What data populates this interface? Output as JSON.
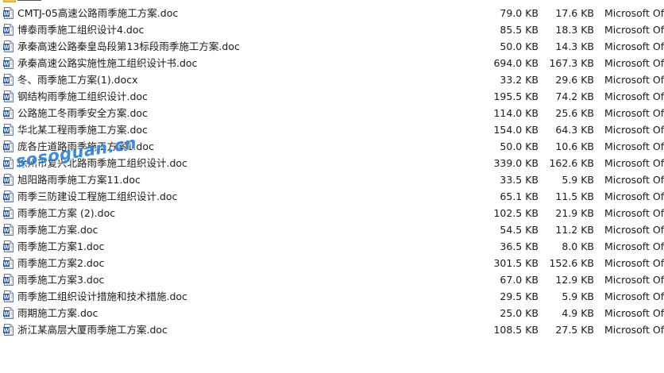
{
  "files": [
    {
      "name": "CMTJ-05高速公路雨季施工方案.doc",
      "size": "79.0 KB",
      "compressed": "17.6 KB",
      "type": "Microsoft Of"
    },
    {
      "name": "博泰雨季施工组织设计4.doc",
      "size": "85.5 KB",
      "compressed": "18.3 KB",
      "type": "Microsoft Of"
    },
    {
      "name": "承秦高速公路秦皇岛段第13标段雨季施工方案.doc",
      "size": "50.0 KB",
      "compressed": "14.3 KB",
      "type": "Microsoft Of"
    },
    {
      "name": "承秦高速公路实施性施工组织设计书.doc",
      "size": "694.0 KB",
      "compressed": "167.3 KB",
      "type": "Microsoft Of"
    },
    {
      "name": "冬、雨季施工方案(1).docx",
      "size": "33.2 KB",
      "compressed": "29.6 KB",
      "type": "Microsoft Of"
    },
    {
      "name": "钢结构雨季施工组织设计.doc",
      "size": "195.5 KB",
      "compressed": "74.2 KB",
      "type": "Microsoft Of"
    },
    {
      "name": "公路施工冬雨季安全方案.doc",
      "size": "114.0 KB",
      "compressed": "25.6 KB",
      "type": "Microsoft Of"
    },
    {
      "name": "华北某工程雨季施工方案.doc",
      "size": "154.0 KB",
      "compressed": "64.3 KB",
      "type": "Microsoft Of"
    },
    {
      "name": "庞各庄道路雨季施工方案1.doc",
      "size": "50.0 KB",
      "compressed": "10.6 KB",
      "type": "Microsoft Of"
    },
    {
      "name": "徐州市复兴北路雨季施工组织设计.doc",
      "size": "339.0 KB",
      "compressed": "162.6 KB",
      "type": "Microsoft Of"
    },
    {
      "name": "旭阳路雨季施工方案11.doc",
      "size": "33.5 KB",
      "compressed": "5.9 KB",
      "type": "Microsoft Of"
    },
    {
      "name": "雨季三防建设工程施工组织设计.doc",
      "size": "65.1 KB",
      "compressed": "11.5 KB",
      "type": "Microsoft Of"
    },
    {
      "name": "雨季施工方案 (2).doc",
      "size": "102.5 KB",
      "compressed": "21.9 KB",
      "type": "Microsoft Of"
    },
    {
      "name": "雨季施工方案.doc",
      "size": "54.5 KB",
      "compressed": "11.2 KB",
      "type": "Microsoft Of"
    },
    {
      "name": "雨季施工方案1.doc",
      "size": "36.5 KB",
      "compressed": "8.0 KB",
      "type": "Microsoft Of"
    },
    {
      "name": "雨季施工方案2.doc",
      "size": "301.5 KB",
      "compressed": "152.6 KB",
      "type": "Microsoft Of"
    },
    {
      "name": "雨季施工方案3.doc",
      "size": "67.0 KB",
      "compressed": "12.9 KB",
      "type": "Microsoft Of"
    },
    {
      "name": "雨季施工组织设计措施和技术措施.doc",
      "size": "29.5 KB",
      "compressed": "5.9 KB",
      "type": "Microsoft Of"
    },
    {
      "name": "雨期施工方案.doc",
      "size": "25.0 KB",
      "compressed": "4.9 KB",
      "type": "Microsoft Of"
    },
    {
      "name": "浙江某高层大厦雨季施工方案.doc",
      "size": "108.5 KB",
      "compressed": "27.5 KB",
      "type": "Microsoft Of"
    }
  ],
  "watermark": "sosoguan.cn",
  "icons": {
    "file": "word-doc-icon",
    "folder": "folder-icon"
  },
  "colors": {
    "word_blue": "#2b5797",
    "watermark": "#2a7fd4"
  }
}
